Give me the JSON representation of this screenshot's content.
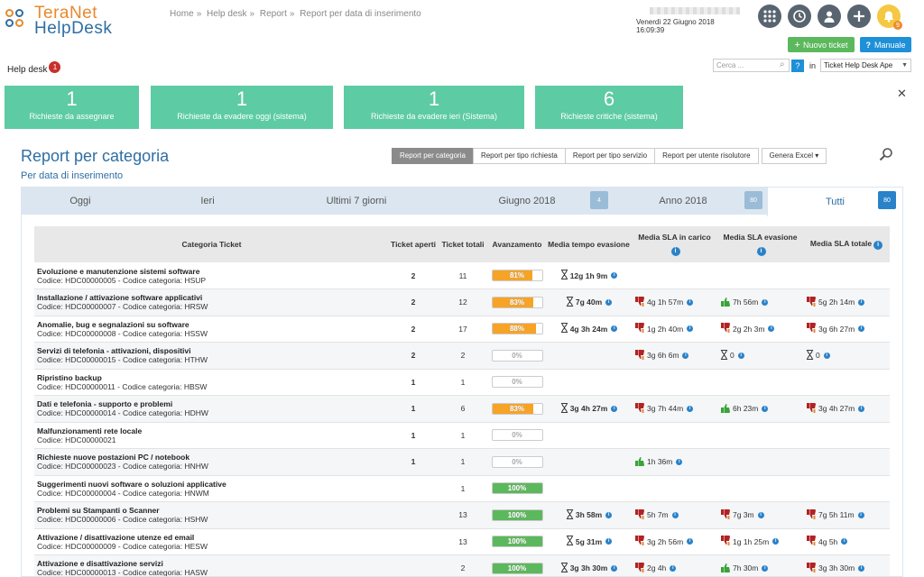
{
  "logo": {
    "line1": "TeraNet",
    "line2": "HelpDesk"
  },
  "breadcrumb": [
    "Home",
    "Help desk",
    "Report",
    "Report per data di inserimento"
  ],
  "user": {
    "date": "Venerdì 22 Giugno 2018 16:09:39"
  },
  "buttons": {
    "nuovo_ticket": "Nuovo ticket",
    "manuale": "Manuale"
  },
  "helpdesk": {
    "label": "Help desk",
    "badge": "1"
  },
  "search": {
    "placeholder": "Cerca ...",
    "help": "?",
    "in_label": "in",
    "select_value": "Ticket Help Desk Ape"
  },
  "cards": [
    {
      "num": "1",
      "label": "Richieste da assegnare"
    },
    {
      "num": "1",
      "label": "Richieste da evadere oggi (sistema)"
    },
    {
      "num": "1",
      "label": "Richieste da evadere ieri (Sistema)"
    },
    {
      "num": "6",
      "label": "Richieste critiche (sistema)"
    }
  ],
  "report": {
    "title": "Report per categoria",
    "subtitle": "Per data di inserimento",
    "buttons": [
      "Report per categoria",
      "Report per tipo richiesta",
      "Report per tipo servizio",
      "Report per utente risolutore",
      "Genera Excel"
    ]
  },
  "period_tabs": [
    {
      "label": "Oggi",
      "badge": ""
    },
    {
      "label": "Ieri",
      "badge": ""
    },
    {
      "label": "Ultimi 7 giorni",
      "badge": ""
    },
    {
      "label": "Giugno 2018",
      "badge": "4"
    },
    {
      "label": "Anno 2018",
      "badge": "80"
    },
    {
      "label": "Tutti",
      "badge": "80"
    }
  ],
  "table": {
    "headers": [
      "Categoria Ticket",
      "Ticket aperti",
      "Ticket totali",
      "Avanzamento",
      "Media tempo evasione",
      "Media SLA in carico",
      "Media SLA evasione",
      "Media SLA totale"
    ],
    "rows": [
      {
        "name": "Evoluzione e manutenzione sistemi software",
        "code": "Codice: HDC00000005 - Codice categoria: HSUP",
        "open": "2",
        "total": "11",
        "progress": 81,
        "avg": "12g 1h 9m",
        "sla_carico": null,
        "sla_evasione": null,
        "sla_totale": null
      },
      {
        "name": "Installazione / attivazione software applicativi",
        "code": "Codice: HDC00000007 - Codice categoria: HRSW",
        "open": "2",
        "total": "12",
        "progress": 83,
        "avg": "7g 40m",
        "sla_carico": {
          "kind": "down",
          "text": "4g 1h 57m"
        },
        "sla_evasione": {
          "kind": "up",
          "text": "7h 56m"
        },
        "sla_totale": {
          "kind": "down",
          "text": "5g 2h 14m"
        }
      },
      {
        "name": "Anomalie, bug e segnalazioni su software",
        "code": "Codice: HDC00000008 - Codice categoria: HSSW",
        "open": "2",
        "total": "17",
        "progress": 88,
        "avg": "4g 3h 24m",
        "sla_carico": {
          "kind": "down",
          "text": "1g 2h 40m"
        },
        "sla_evasione": {
          "kind": "down",
          "text": "2g 2h 3m"
        },
        "sla_totale": {
          "kind": "down",
          "text": "3g 6h 27m"
        }
      },
      {
        "name": "Servizi di telefonia - attivazioni, dispositivi",
        "code": "Codice: HDC00000015 - Codice categoria: HTHW",
        "open": "2",
        "total": "2",
        "progress": 0,
        "avg": "",
        "sla_carico": {
          "kind": "down",
          "text": "3g 6h 6m"
        },
        "sla_evasione": {
          "kind": "hour",
          "text": "0"
        },
        "sla_totale": {
          "kind": "hour",
          "text": "0"
        }
      },
      {
        "name": "Ripristino backup",
        "code": "Codice: HDC00000011 - Codice categoria: HBSW",
        "open": "1",
        "total": "1",
        "progress": 0,
        "avg": "",
        "sla_carico": null,
        "sla_evasione": null,
        "sla_totale": null
      },
      {
        "name": "Dati e telefonia - supporto e problemi",
        "code": "Codice: HDC00000014 - Codice categoria: HDHW",
        "open": "1",
        "total": "6",
        "progress": 83,
        "avg": "3g 4h 27m",
        "sla_carico": {
          "kind": "down",
          "text": "3g 7h 44m"
        },
        "sla_evasione": {
          "kind": "up",
          "text": "6h 23m"
        },
        "sla_totale": {
          "kind": "down",
          "text": "3g 4h 27m"
        }
      },
      {
        "name": "Malfunzionamenti rete locale",
        "code": "Codice: HDC00000021",
        "open": "1",
        "total": "1",
        "progress": 0,
        "avg": "",
        "sla_carico": null,
        "sla_evasione": null,
        "sla_totale": null
      },
      {
        "name": "Richieste nuove postazioni PC / notebook",
        "code": "Codice: HDC00000023 - Codice categoria: HNHW",
        "open": "1",
        "total": "1",
        "progress": 0,
        "avg": "",
        "sla_carico": {
          "kind": "up",
          "text": "1h 36m"
        },
        "sla_evasione": null,
        "sla_totale": null
      },
      {
        "name": "Suggerimenti nuovi software o soluzioni applicative",
        "code": "Codice: HDC00000004 - Codice categoria: HNWM",
        "open": "",
        "total": "1",
        "progress": 100,
        "avg": "",
        "sla_carico": null,
        "sla_evasione": null,
        "sla_totale": null
      },
      {
        "name": "Problemi su Stampanti o Scanner",
        "code": "Codice: HDC00000006 - Codice categoria: HSHW",
        "open": "",
        "total": "13",
        "progress": 100,
        "avg": "3h 58m",
        "sla_carico": {
          "kind": "down",
          "text": "5h 7m"
        },
        "sla_evasione": {
          "kind": "down",
          "text": "7g 3m"
        },
        "sla_totale": {
          "kind": "down",
          "text": "7g 5h 11m"
        }
      },
      {
        "name": "Attivazione / disattivazione utenze ed email",
        "code": "Codice: HDC00000009 - Codice categoria: HESW",
        "open": "",
        "total": "13",
        "progress": 100,
        "avg": "5g 31m",
        "sla_carico": {
          "kind": "down",
          "text": "3g 2h 56m"
        },
        "sla_evasione": {
          "kind": "down",
          "text": "1g 1h 25m"
        },
        "sla_totale": {
          "kind": "down",
          "text": "4g 5h"
        }
      },
      {
        "name": "Attivazione e disattivazione servizi",
        "code": "Codice: HDC00000013 - Codice categoria: HASW",
        "open": "",
        "total": "2",
        "progress": 100,
        "avg": "3g 3h 30m",
        "sla_carico": {
          "kind": "down",
          "text": "2g 4h"
        },
        "sla_evasione": {
          "kind": "up",
          "text": "7h 30m"
        },
        "sla_totale": {
          "kind": "down",
          "text": "3g 3h 30m"
        }
      }
    ]
  },
  "colors": {
    "brand_orange": "#e8892c",
    "brand_blue": "#2e6ea4",
    "card_green": "#5dcba4",
    "progress_orange": "#f7a326",
    "progress_green": "#5cb85c",
    "thumb_down": "#b22222",
    "thumb_up": "#3aa33a"
  }
}
